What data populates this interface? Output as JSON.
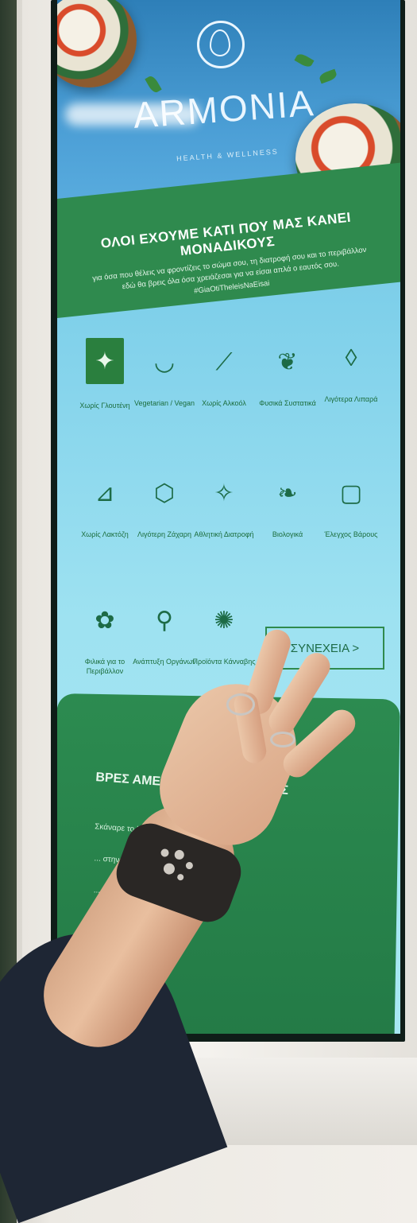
{
  "brand": {
    "name": "ARMONIA",
    "tagline": "HEALTH & WELLNESS"
  },
  "banner": {
    "title": "ΟΛΟΙ ΕΧΟΥΜΕ ΚΑΤΙ ΠΟΥ ΜΑΣ ΚΑΝΕΙ ΜΟΝΑΔΙΚΟΥΣ",
    "line1": "για όσα που θέλεις να φροντίζεις το σώμα σου, τη διατροφή σου και το περιβάλλον",
    "line2": "εδώ θα βρεις όλα όσα χρειάζεσαι για να είσαι απλά ο εαυτός σου.",
    "hashtag": "#GiaOtiTheleisNaEisai"
  },
  "options": [
    {
      "label": "Χωρίς Γλουτένη",
      "icon": "gluten-free-icon",
      "glyph": "✦",
      "selected": true
    },
    {
      "label": "Vegetarian / Vegan",
      "icon": "bowl-icon",
      "glyph": "◡",
      "selected": false
    },
    {
      "label": "Χωρίς Αλκοόλ",
      "icon": "no-alcohol-icon",
      "glyph": "⟋",
      "selected": false
    },
    {
      "label": "Φυσικά Συστατικά",
      "icon": "leaves-icon",
      "glyph": "❦",
      "selected": false
    },
    {
      "label": "Λιγότερα Λιπαρά",
      "icon": "drops-icon",
      "glyph": "◊",
      "selected": false
    },
    {
      "label": "Χωρίς Λακτόζη",
      "icon": "milk-bottle-icon",
      "glyph": "⊿",
      "selected": false
    },
    {
      "label": "Λιγότερη Ζάχαρη",
      "icon": "sugar-icon",
      "glyph": "⬡",
      "selected": false
    },
    {
      "label": "Αθλητική Διατροφή",
      "icon": "runner-icon",
      "glyph": "✧",
      "selected": false
    },
    {
      "label": "Βιολογικά",
      "icon": "wheat-icon",
      "glyph": "❧",
      "selected": false
    },
    {
      "label": "Έλεγχος Βάρους",
      "icon": "scale-icon",
      "glyph": "▢",
      "selected": false
    },
    {
      "label": "Φιλικά για το Περιβάλλον",
      "icon": "plant-hand-icon",
      "glyph": "✿",
      "selected": false
    },
    {
      "label": "Ανάπτυξη Οργάνων",
      "icon": "growth-icon",
      "glyph": "⚲",
      "selected": false
    },
    {
      "label": "Προϊόντα Κάνναβης",
      "icon": "cannabis-leaf-icon",
      "glyph": "✺",
      "selected": false
    }
  ],
  "continue_label": "ΣΥΝΕΧΕΙΑ >",
  "info_panel": {
    "title": "ΒΡΕΣ ΑΜΕΣΑ ... ΠΛΗΡΟΦΟΡΙΕΣ",
    "items": [
      "Σκάναρε το barcode στην ειδική ...",
      "... στην οθόνη όλες οι ...",
      "... προϊόν ή πληροφορίες μέσω των ..."
    ]
  }
}
